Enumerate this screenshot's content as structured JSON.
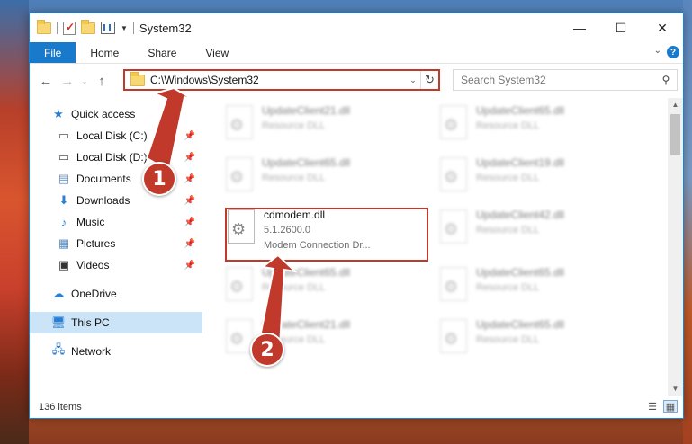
{
  "window": {
    "title": "System32",
    "controls": {
      "minimize": "—",
      "maximize": "☐",
      "close": "✕"
    }
  },
  "ribbon": {
    "tabs": [
      "File",
      "Home",
      "Share",
      "View"
    ]
  },
  "address": {
    "path": "C:\\Windows\\System32",
    "search_placeholder": "Search System32"
  },
  "sidebar": {
    "quick_access": "Quick access",
    "pinned": [
      {
        "label": "Local Disk (C:)",
        "icon": "drive-icon"
      },
      {
        "label": "Local Disk (D:)",
        "icon": "drive-icon"
      },
      {
        "label": "Documents",
        "icon": "documents-icon"
      },
      {
        "label": "Downloads",
        "icon": "downloads-icon"
      },
      {
        "label": "Music",
        "icon": "music-icon"
      },
      {
        "label": "Pictures",
        "icon": "pictures-icon"
      },
      {
        "label": "Videos",
        "icon": "videos-icon"
      }
    ],
    "onedrive": "OneDrive",
    "this_pc": "This PC",
    "network": "Network"
  },
  "files": {
    "left": [
      {
        "name": "UpdateClient21.dll",
        "desc": "Resource DLL"
      },
      {
        "name": "UpdateClient65.dll",
        "desc": "Resource DLL"
      },
      {
        "name": "cdmodem.dll",
        "version": "5.1.2600.0",
        "desc": "Modem Connection Dr..."
      },
      {
        "name": "UpdateClient65.dll",
        "desc": "Resource DLL"
      },
      {
        "name": "UpdateClient21.dll",
        "desc": "Resource DLL"
      }
    ],
    "right": [
      {
        "name": "UpdateClient65.dll",
        "desc": "Resource DLL"
      },
      {
        "name": "UpdateClient19.dll",
        "desc": "Resource DLL"
      },
      {
        "name": "UpdateClient42.dll",
        "desc": "Resource DLL"
      },
      {
        "name": "UpdateClient65.dll",
        "desc": "Resource DLL"
      },
      {
        "name": "UpdateClient65.dll",
        "desc": "Resource DLL"
      }
    ]
  },
  "status": {
    "items": "136 items"
  },
  "annotations": {
    "step1": "1",
    "step2": "2",
    "color": "#c0392b"
  }
}
